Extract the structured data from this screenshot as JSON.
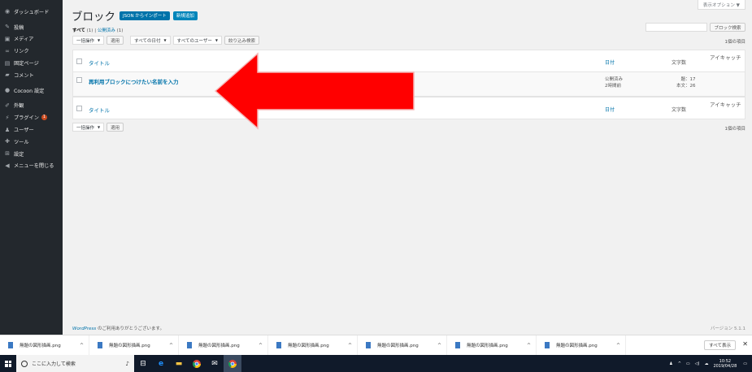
{
  "sidebar": {
    "items": [
      {
        "icon": "dashboard-icon",
        "glyph": "◉",
        "label": "ダッシュボード"
      },
      {
        "icon": "pin-icon",
        "glyph": "✎",
        "label": "投稿"
      },
      {
        "icon": "media-icon",
        "glyph": "▣",
        "label": "メディア"
      },
      {
        "icon": "link-icon",
        "glyph": "∞",
        "label": "リンク"
      },
      {
        "icon": "page-icon",
        "glyph": "▤",
        "label": "固定ページ"
      },
      {
        "icon": "comment-icon",
        "glyph": "▰",
        "label": "コメント"
      },
      {
        "icon": "cocoon-icon",
        "glyph": "●",
        "label": "Cocoon 設定"
      },
      {
        "icon": "appearance-icon",
        "glyph": "✐",
        "label": "外観"
      },
      {
        "icon": "plugin-icon",
        "glyph": "⚡",
        "label": "プラグイン",
        "badge": "1"
      },
      {
        "icon": "user-icon",
        "glyph": "♟",
        "label": "ユーザー"
      },
      {
        "icon": "tools-icon",
        "glyph": "✚",
        "label": "ツール"
      },
      {
        "icon": "settings-icon",
        "glyph": "⊞",
        "label": "設定"
      },
      {
        "icon": "collapse-icon",
        "glyph": "◀",
        "label": "メニューを閉じる"
      }
    ]
  },
  "header": {
    "screen_options": "表示オプション ▼",
    "title": "ブロック",
    "import_button": "JSON からインポート",
    "add_new_button": "新規追加"
  },
  "filters": {
    "all": "すべて",
    "all_count": "(1)",
    "separator": "|",
    "published": "公開済み",
    "published_count": "(1)"
  },
  "search": {
    "button": "ブロック検索",
    "placeholder": ""
  },
  "tablenav": {
    "bulk_action": "一括操作",
    "apply": "適用",
    "all_dates": "すべての日付",
    "all_users": "すべてのユーザー",
    "filter": "絞り込み検索",
    "count": "1個の項目"
  },
  "table": {
    "columns": {
      "title": "タイトル",
      "date": "日付",
      "words": "文字数",
      "eyecatch": "アイキャッチ"
    },
    "rows": [
      {
        "title": "再利用ブロックにつけたい名前を入力",
        "date_status": "公開済み",
        "date_value": "2時間前",
        "words_title": "題：17",
        "words_body": "本文：26"
      }
    ]
  },
  "footer": {
    "wp_link": "WordPress",
    "thanks": " のご利用ありがとうございます。",
    "version": "バージョン 5.1.1"
  },
  "downloads": {
    "items": [
      "無題の図形描画.png",
      "無題の図形描画.png",
      "無題の図形描画.png",
      "無題の図形描画.png",
      "無題の図形描画.png",
      "無題の図形描画.png",
      "無題の図形描画.png"
    ],
    "show_all": "すべて表示",
    "close": "✕"
  },
  "taskbar": {
    "search_placeholder": "ここに入力して検索",
    "time": "10:52",
    "date": "2019/04/28"
  },
  "colors": {
    "sidebar": "#23282d",
    "accent": "#0073aa",
    "arrow": "#ff0000"
  }
}
